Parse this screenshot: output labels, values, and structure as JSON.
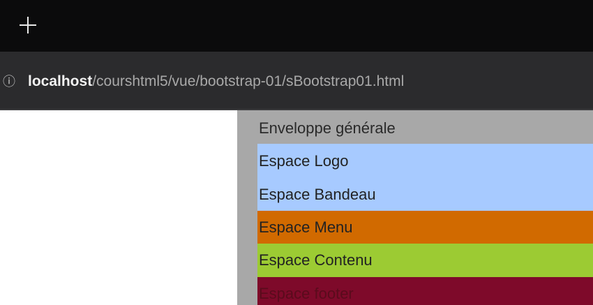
{
  "browser": {
    "new_tab_icon": "plus-icon",
    "info_icon": "info-circle-icon",
    "url_host": "localhost",
    "url_path": "/courshtml5/vue/bootstrap-01/sBootstrap01.html"
  },
  "page": {
    "wrapper_label": "Enveloppe générale",
    "logo_label": "Espace Logo",
    "bandeau_label": "Espace Bandeau",
    "menu_label": "Espace Menu",
    "contenu_label": "Espace Contenu",
    "footer_label": "Espace footer"
  },
  "colors": {
    "wrapper": "#a8a8a8",
    "logo_bandeau": "#a7caff",
    "menu": "#d16a00",
    "contenu": "#9ccb33",
    "footer": "#7e0a2a"
  }
}
